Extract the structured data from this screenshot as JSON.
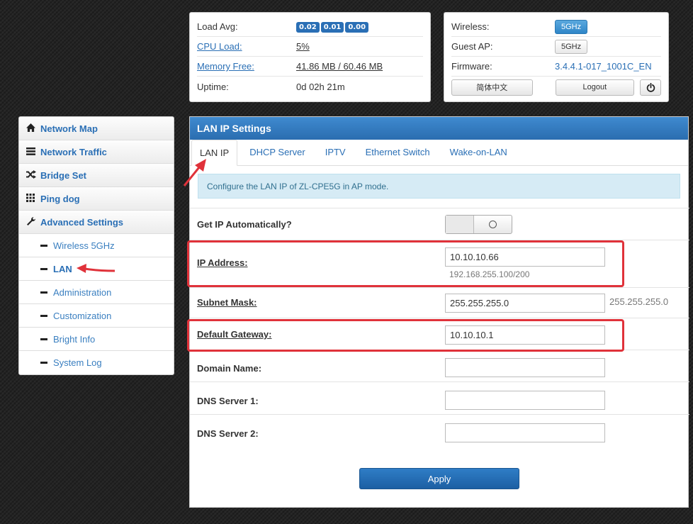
{
  "status": {
    "load_avg_label": "Load Avg:",
    "load_avg_values": [
      "0.02",
      "0.01",
      "0.00"
    ],
    "cpu_label": "CPU Load:",
    "cpu_value": "5%",
    "mem_label": "Memory Free:",
    "mem_value": "41.86 MB / 60.46 MB",
    "uptime_label": "Uptime:",
    "uptime_value": "0d 02h 21m"
  },
  "system": {
    "wireless_label": "Wireless:",
    "wireless_value": "5GHz",
    "guest_label": "Guest AP:",
    "guest_value": "5GHz",
    "firmware_label": "Firmware:",
    "firmware_value": "3.4.4.1-017_1001C_EN",
    "lang_button": "简体中文",
    "logout_button": "Logout",
    "power_icon": "power-icon"
  },
  "sidebar": {
    "items": [
      {
        "label": "Network Map",
        "icon": "home-icon"
      },
      {
        "label": "Network Traffic",
        "icon": "list-icon"
      },
      {
        "label": "Bridge Set",
        "icon": "shuffle-icon"
      },
      {
        "label": "Ping dog",
        "icon": "grid-icon"
      },
      {
        "label": "Advanced Settings",
        "icon": "wrench-icon"
      }
    ],
    "sub_items": [
      {
        "label": "Wireless 5GHz"
      },
      {
        "label": "LAN"
      },
      {
        "label": "Administration"
      },
      {
        "label": "Customization"
      },
      {
        "label": "Bright Info"
      },
      {
        "label": "System Log"
      }
    ]
  },
  "panel": {
    "title": "LAN IP Settings",
    "tabs": [
      "LAN IP",
      "DHCP Server",
      "IPTV",
      "Ethernet Switch",
      "Wake-on-LAN"
    ],
    "info": "Configure the LAN IP of ZL-CPE5G in AP mode.",
    "get_ip_label": "Get IP Automatically?",
    "ip_label": "IP Address:",
    "ip_value": "10.10.10.66",
    "ip_hint": "192.168.255.100/200",
    "mask_label": "Subnet Mask:",
    "mask_value": "255.255.255.0",
    "mask_hint": "255.255.255.0",
    "gw_label": "Default Gateway:",
    "gw_value": "10.10.10.1",
    "domain_label": "Domain Name:",
    "domain_value": "",
    "dns1_label": "DNS Server 1:",
    "dns1_value": "",
    "dns2_label": "DNS Server 2:",
    "dns2_value": "",
    "apply_button": "Apply"
  },
  "colors": {
    "accent": "#2a6fb5",
    "annotation": "#e0323a",
    "info_bg": "#d6ebf5"
  }
}
